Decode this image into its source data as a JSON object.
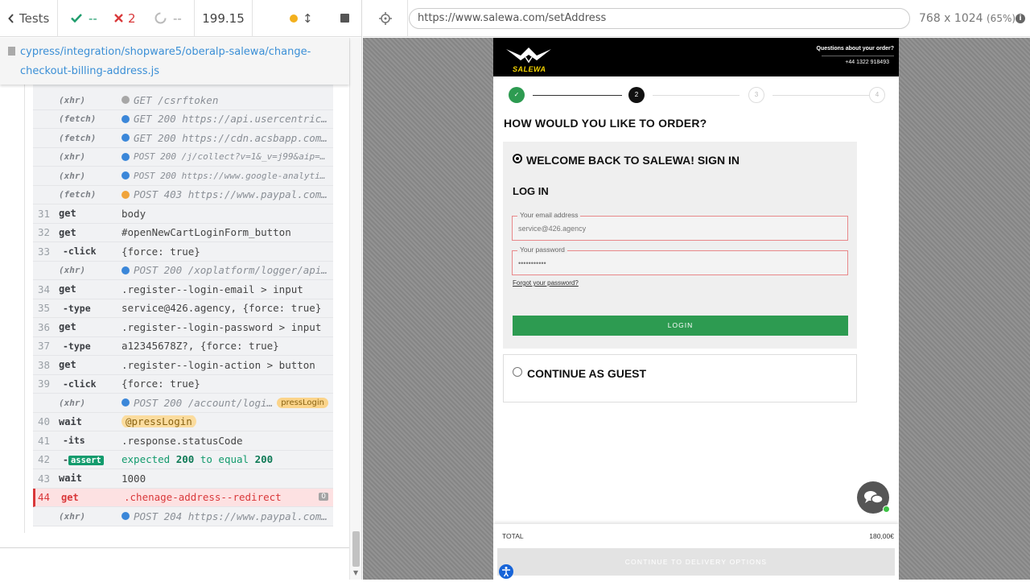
{
  "reporter": {
    "tests_label": "Tests",
    "passed": "--",
    "failed": "2",
    "pending": "--",
    "duration": "199.15",
    "spec_path": "cypress/integration/shopware5/oberalp-salewa/change-checkout-billing-address.js",
    "commands": [
      {
        "type": "req",
        "name": "(xhr)",
        "dot": "grey",
        "text": "GET /csrftoken"
      },
      {
        "type": "req",
        "name": "(fetch)",
        "dot": "blue",
        "text": "GET 200 https://api.usercentrics.eu/settings/..."
      },
      {
        "type": "req",
        "name": "(fetch)",
        "dot": "blue",
        "text": "GET 200 https://cdn.acsbapp.com/config/..."
      },
      {
        "type": "req",
        "name": "(xhr)",
        "dot": "blue",
        "text": "POST 200 /j/collect?v=1&_v=j99&aip=1&...",
        "small": true
      },
      {
        "type": "req",
        "name": "(xhr)",
        "dot": "blue",
        "text": "POST 200 https://www.google-analytics.com/...",
        "small": true
      },
      {
        "type": "req",
        "name": "(fetch)",
        "dot": "orange",
        "text": "POST 403 https://www.paypal.com/xoplatform/..."
      },
      {
        "type": "cmd",
        "num": "31",
        "name": "get",
        "msg": "body"
      },
      {
        "type": "cmd",
        "num": "32",
        "name": "get",
        "msg": "#openNewCartLoginForm_button"
      },
      {
        "type": "cmd",
        "num": "33",
        "name": "-click",
        "child": true,
        "msg": "{force: true}"
      },
      {
        "type": "req",
        "name": "(xhr)",
        "dot": "blue",
        "text": "POST 200 /xoplatform/logger/api/logger"
      },
      {
        "type": "cmd",
        "num": "34",
        "name": "get",
        "msg": ".register--login-email > input"
      },
      {
        "type": "cmd",
        "num": "35",
        "name": "-type",
        "child": true,
        "msg": "service@426.agency, {force: true}"
      },
      {
        "type": "cmd",
        "num": "36",
        "name": "get",
        "msg": ".register--login-password > input"
      },
      {
        "type": "cmd",
        "num": "37",
        "name": "-type",
        "child": true,
        "msg": "a12345678Z?, {force: true}"
      },
      {
        "type": "cmd",
        "num": "38",
        "name": "get",
        "msg": ".register--login-action > button"
      },
      {
        "type": "cmd",
        "num": "39",
        "name": "-click",
        "child": true,
        "msg": "{force: true}"
      },
      {
        "type": "req",
        "name": "(xhr)",
        "dot": "blue",
        "text": "POST 200 /account/login/sTarget/...",
        "alias": "pressLogin"
      },
      {
        "type": "wait",
        "num": "40",
        "name": "wait",
        "msg": "@pressLogin"
      },
      {
        "type": "cmd",
        "num": "41",
        "name": "-its",
        "child": true,
        "msg": ".response.statusCode"
      },
      {
        "type": "assert",
        "num": "42",
        "name": "assert",
        "expected": "200",
        "actual": "200"
      },
      {
        "type": "cmd",
        "num": "43",
        "name": "wait",
        "msg": "1000"
      },
      {
        "type": "failed",
        "num": "44",
        "name": "get",
        "msg": ".chenage-address--redirect",
        "count": "0"
      },
      {
        "type": "req",
        "name": "(xhr)",
        "dot": "blue",
        "text": "POST 204 https://www.paypal.com/xoplatform/..."
      }
    ],
    "assert_words": {
      "expected": "expected",
      "to_equal": "to equal"
    }
  },
  "aut": {
    "url": "https://www.salewa.com/setAddress",
    "viewport": "768 x 1024",
    "scale": "(65%)"
  },
  "site": {
    "brand": "SALEWA",
    "help_question": "Questions about your order?",
    "help_phone": "+44 1322 918493",
    "steps": [
      "✓",
      "2",
      "3",
      "4"
    ],
    "order_title": "HOW WOULD YOU LIKE TO ORDER?",
    "welcome_label": "WELCOME BACK TO SALEWA! SIGN IN",
    "login_heading": "LOG IN",
    "email_label": "Your email address",
    "email_value": "service@426.agency",
    "password_label": "Your password",
    "password_value": "•••••••••••",
    "forgot_link": "Forgot your password?",
    "login_button": "LOGIN",
    "guest_label": "CONTINUE AS GUEST",
    "total_label": "TOTAL",
    "total_value": "180,00€",
    "continue_button": "CONTINUE TO DELIVERY OPTIONS"
  },
  "colors": {
    "accent_green": "#2d9b51",
    "passed": "#1f9d6d",
    "failed": "#d9383a",
    "brand_yellow": "#f3d300"
  }
}
